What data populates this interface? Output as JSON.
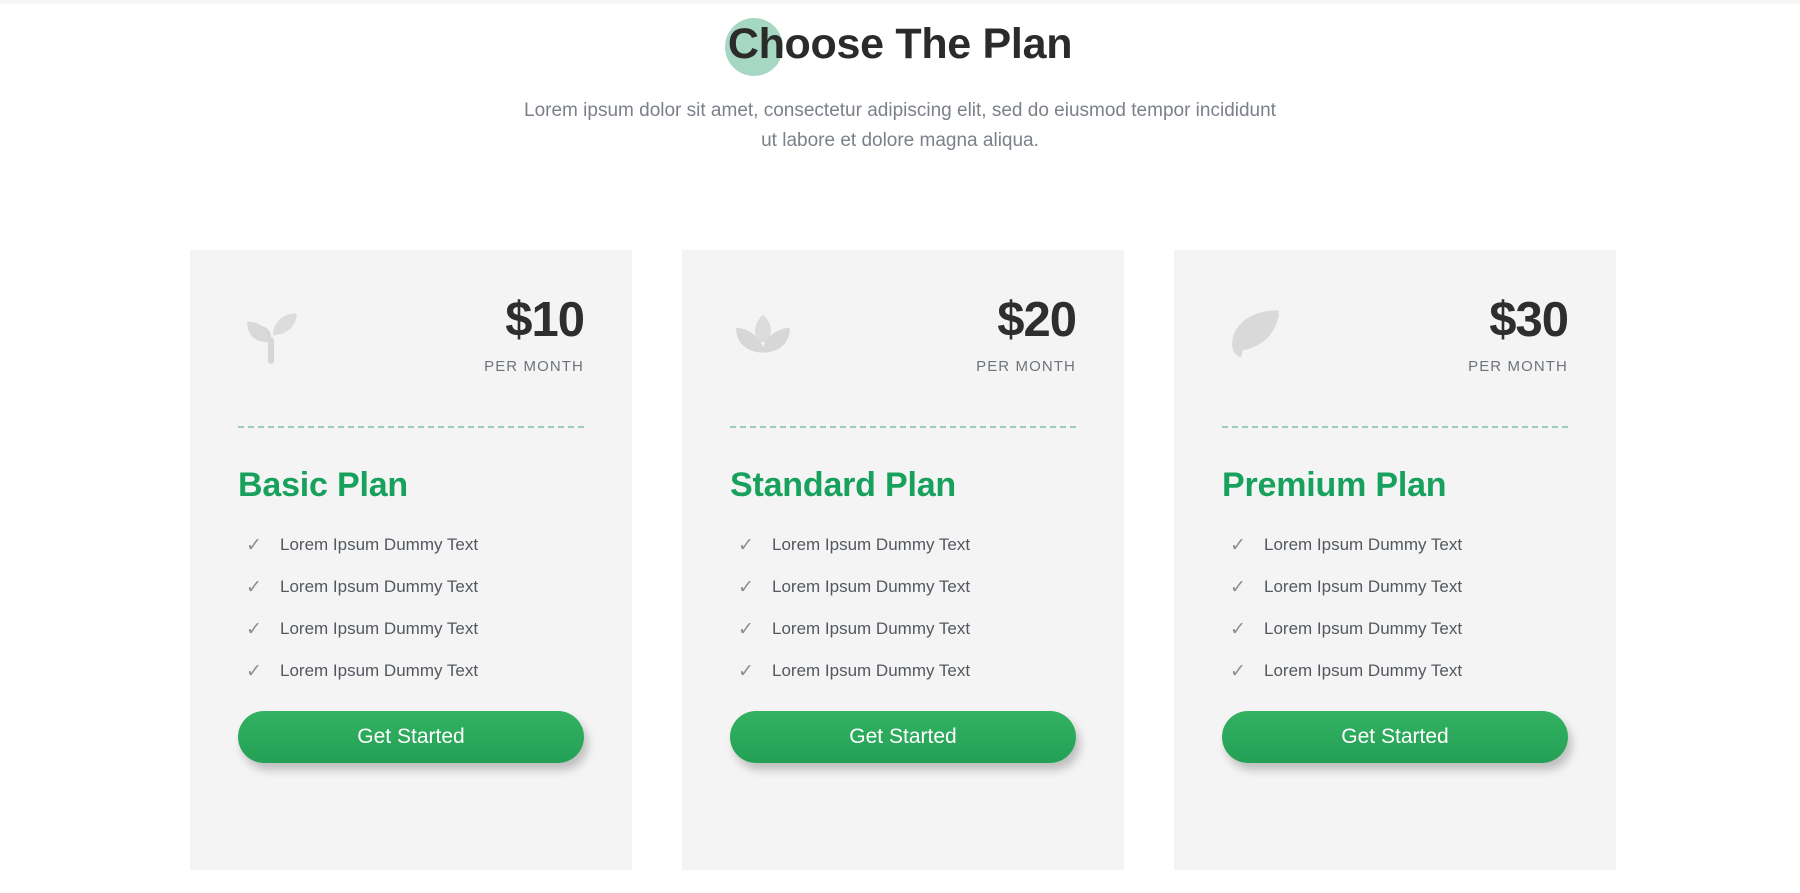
{
  "header": {
    "title": "Choose The Plan",
    "subtitle": "Lorem ipsum dolor sit amet, consectetur adipiscing elit, sed do eiusmod tempor incididunt ut labore et dolore magna aliqua."
  },
  "colors": {
    "accent_green": "#17a15c",
    "button_green": "#2ca85b",
    "title_blob": "#a6d7c3",
    "card_background": "#f4f4f4",
    "divider": "#53a896",
    "icon_gray": "#d7d7d7",
    "price_text": "#2e2e2e",
    "muted_text": "#7b8089"
  },
  "cards": [
    {
      "icon": "sprout-icon",
      "price": "$10",
      "period": "PER MONTH",
      "name": "Basic Plan",
      "features": [
        "Lorem Ipsum Dummy Text",
        "Lorem Ipsum Dummy Text",
        "Lorem Ipsum Dummy Text",
        "Lorem Ipsum Dummy Text"
      ],
      "check_glyph": "✓",
      "cta_label": "Get Started"
    },
    {
      "icon": "lotus-icon",
      "price": "$20",
      "period": "PER MONTH",
      "name": "Standard Plan",
      "features": [
        "Lorem Ipsum Dummy Text",
        "Lorem Ipsum Dummy Text",
        "Lorem Ipsum Dummy Text",
        "Lorem Ipsum Dummy Text"
      ],
      "check_glyph": "✓",
      "cta_label": "Get Started"
    },
    {
      "icon": "leaf-icon",
      "price": "$30",
      "period": "PER MONTH",
      "name": "Premium Plan",
      "features": [
        "Lorem Ipsum Dummy Text",
        "Lorem Ipsum Dummy Text",
        "Lorem Ipsum Dummy Text",
        "Lorem Ipsum Dummy Text"
      ],
      "check_glyph": "✓",
      "cta_label": "Get Started"
    }
  ]
}
